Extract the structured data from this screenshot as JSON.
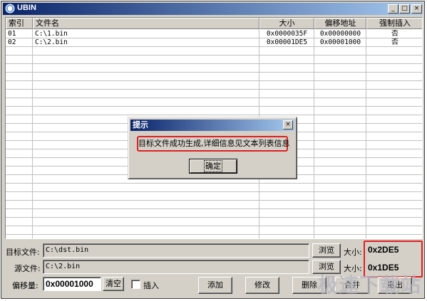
{
  "window": {
    "title": "UBIN",
    "min_label": "_",
    "max_label": "□",
    "close_label": "×"
  },
  "columns": [
    "索引",
    "文件名",
    "大小",
    "偏移地址",
    "强制插入"
  ],
  "rows": [
    {
      "index": "01",
      "file": "C:\\1.bin",
      "size": "0x0000035F",
      "offset": "0x00000000",
      "force": "否"
    },
    {
      "index": "02",
      "file": "C:\\2.bin",
      "size": "0x00001DE5",
      "offset": "0x00001000",
      "force": "否"
    }
  ],
  "dialog": {
    "title": "提示",
    "message": "目标文件成功生成,详细信息见文本列表信息",
    "ok_label": "确定",
    "close_label": "×"
  },
  "target": {
    "label": "目标文件:",
    "value": "C:\\dst.bin",
    "browse_label": "浏览",
    "size_label": "大小:",
    "size_value": "0x2DE5"
  },
  "source": {
    "label": "源文件:",
    "value": "C:\\2.bin",
    "browse_label": "浏览",
    "size_label": "大小:",
    "size_value": "0x1DE5"
  },
  "offset": {
    "label": "偏移量:",
    "value": "0x00001000",
    "clear_label": "清空",
    "insert_label": "插入"
  },
  "buttons": {
    "add": "添加",
    "modify": "修改",
    "delete": "删除",
    "merge": "合并",
    "exit": "退出"
  },
  "watermark": "极速下载站",
  "colors": {
    "titlebar_start": "#0a246a",
    "titlebar_end": "#a6caf0",
    "highlight_red": "#e02020",
    "face": "#d4d0c8"
  }
}
